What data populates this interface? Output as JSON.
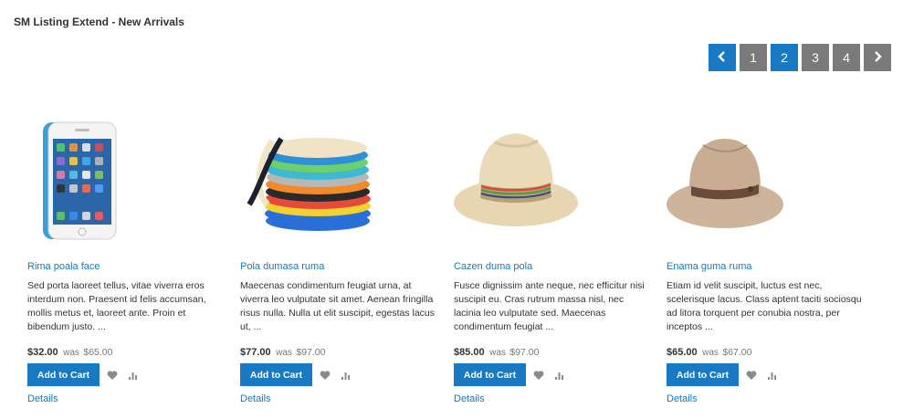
{
  "block": {
    "title": "SM Listing Extend - New Arrivals"
  },
  "pager": {
    "prev_icon": "chevron-left-icon",
    "next_icon": "chevron-right-icon",
    "pages": [
      "1",
      "2",
      "3",
      "4"
    ],
    "active_page": "2"
  },
  "colors": {
    "accent": "#1979c3",
    "pager_inactive": "#7a7a7a"
  },
  "products": [
    {
      "name": "Rima poala face",
      "description": " Sed porta laoreet tellus, vitae viverra eros interdum non. Praesent id felis accumsan, mollis metus et, laoreet ante. Proin et bibendum justo. ...",
      "price": "$32.00",
      "was_label": "was",
      "old_price": "$65.00",
      "add_to_cart": "Add to Cart",
      "details": "Details"
    },
    {
      "name": "Pola dumasa ruma",
      "description": " Maecenas condimentum feugiat urna, at viverra leo vulputate sit amet. Aenean fringilla risus nulla. Nulla ut elit suscipit, egestas lacus ut, ...",
      "price": "$77.00",
      "was_label": "was",
      "old_price": "$97.00",
      "add_to_cart": "Add to Cart",
      "details": "Details"
    },
    {
      "name": "Cazen duma pola",
      "description": " Fusce dignissim ante neque, nec efficitur nisi suscipit eu. Cras rutrum massa nisl, nec lacinia leo vulputate sed. Maecenas condimentum feugiat ...",
      "price": "$85.00",
      "was_label": "was",
      "old_price": "$97.00",
      "add_to_cart": "Add to Cart",
      "details": "Details"
    },
    {
      "name": "Enama guma ruma",
      "description": "Etiam id velit suscipit, luctus est nec, scelerisque lacus. Class aptent taciti sociosqu ad litora torquent per conubia nostra, per inceptos ...",
      "price": "$65.00",
      "was_label": "was",
      "old_price": "$67.00",
      "add_to_cart": "Add to Cart",
      "details": "Details"
    }
  ]
}
